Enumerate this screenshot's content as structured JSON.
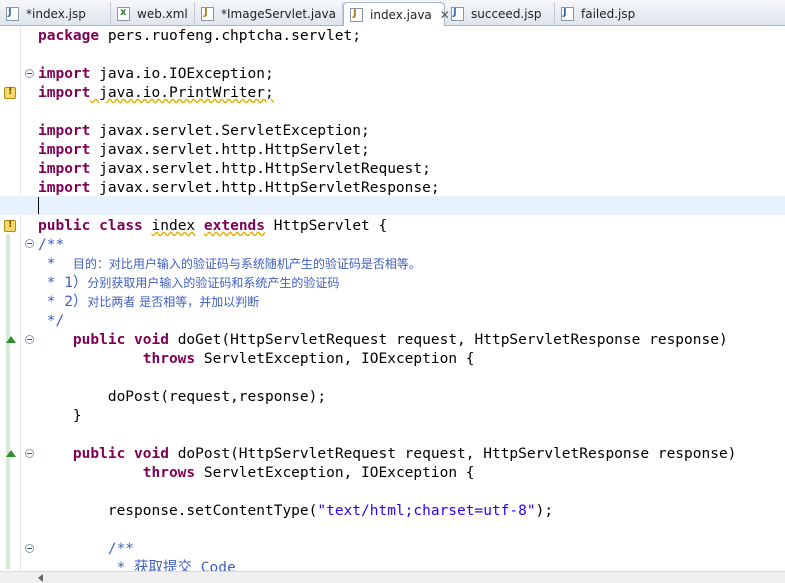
{
  "tabs": [
    {
      "label": "*index.jsp",
      "icon": "jsp-file-icon",
      "active": false
    },
    {
      "label": "web.xml",
      "icon": "xml-file-icon",
      "active": false
    },
    {
      "label": "*ImageServlet.java",
      "icon": "java-file-icon",
      "active": false
    },
    {
      "label": "index.java",
      "icon": "java-file-icon",
      "active": true,
      "close": "✕"
    },
    {
      "label": "succeed.jsp",
      "icon": "jsp-file-icon",
      "active": false
    },
    {
      "label": "failed.jsp",
      "icon": "jsp-file-icon",
      "active": false
    }
  ],
  "code": {
    "package_kw": "package",
    "package_name": " pers.ruofeng.chptcha.servlet;",
    "import_kw": "import",
    "import1": " java.io.IOException;",
    "import2": " java.io.PrintWriter;",
    "import3": " javax.servlet.ServletException;",
    "import4": " javax.servlet.http.HttpServlet;",
    "import5": " javax.servlet.http.HttpServletRequest;",
    "import6": " javax.servlet.http.HttpServletResponse;",
    "class_public": "public",
    "class_class": "class",
    "class_name": "index",
    "class_extends": "extends",
    "class_rest": " HttpServlet {",
    "c_open": "/**",
    "c1_prefix": " *  ",
    "c1_text": "目的：对比用户输入的验证码与系统随机产生的验证码是否相等。",
    "c2_prefix": " * 1）",
    "c2_text": "分别获取用户输入的验证码和系统产生的验证码",
    "c3_prefix": " * 2）",
    "c3_text": "对比两者 是否相等，并加以判断",
    "c_close": " */",
    "m_public": "public",
    "m_void": "void",
    "m1_sig": " doGet(HttpServletRequest request, HttpServletResponse response)",
    "throws_kw": "throws",
    "throws_rest": " ServletException, IOException {",
    "m1_body": "doPost(request,response);",
    "close_brace": "}",
    "m2_sig": " doPost(HttpServletRequest request, HttpServletResponse response)",
    "m2_call": "response.setContentType(",
    "m2_str": "\"text/html;charset=utf-8\"",
    "m2_end": ");",
    "c2_open": "/**",
    "c2_line": " * 获取提交 Code"
  },
  "colors": {
    "keyword": "#7f0055",
    "comment": "#3f5fbf",
    "string": "#2a00ff",
    "current_line": "#e8f2fe"
  }
}
